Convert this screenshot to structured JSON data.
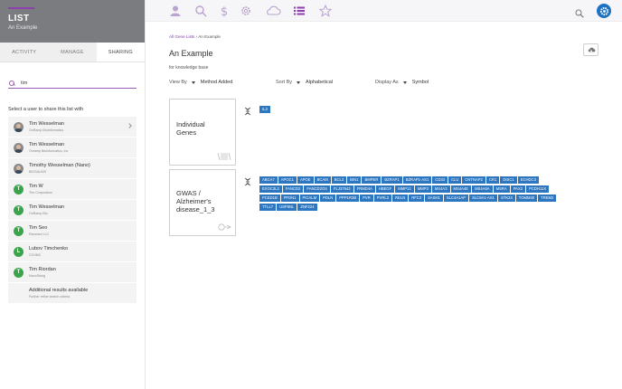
{
  "list_header": {
    "title": "LIST",
    "subtitle": "An Example"
  },
  "tabs": [
    {
      "label": "ACTIVITY"
    },
    {
      "label": "MANAGE"
    },
    {
      "label": "SHARING"
    }
  ],
  "search": {
    "value": "tim",
    "placeholder": ""
  },
  "select_label": "Select a user to share this list with",
  "users": [
    {
      "name": "Tim Wesselman",
      "org": "OnRamp BioInformatics",
      "avatar": "photo"
    },
    {
      "name": "Tim Wesselman",
      "org": "Onramp Bioinformatics, Inc",
      "avatar": "photo"
    },
    {
      "name": "Timothy Wesselman (Nano)",
      "org": "BIOSALINS",
      "avatar": "photo"
    },
    {
      "name": "Tim W",
      "org": "The Corporation",
      "avatar": "T"
    },
    {
      "name": "Tim Wesselman",
      "org": "OnRamp Bio",
      "avatar": "T"
    },
    {
      "name": "Tim Seo",
      "org": "Rammed LLC",
      "avatar": "T"
    },
    {
      "name": "Lubov Timchenko",
      "org": "CCHMC",
      "avatar": "L"
    },
    {
      "name": "Tim Riordan",
      "org": "NanoString",
      "avatar": "T"
    }
  ],
  "more": {
    "title": "Additional results available",
    "note": "Further refine search criteria"
  },
  "topnav": {
    "icons": [
      "user-icon",
      "search-icon",
      "dollar-icon",
      "gear-icon",
      "cloud-icon",
      "list-icon",
      "star-icon"
    ],
    "active": "list-icon",
    "accent": "#1d72c4",
    "brand": "#8e3fb0"
  },
  "breadcrumb": {
    "root": "All Gene Lists",
    "sep": "›",
    "current": "An Example"
  },
  "page": {
    "title": "An Example",
    "subtitle": "for knowledge base"
  },
  "controls": {
    "view_by": {
      "label": "View By",
      "value": "Method Added"
    },
    "sort_by": {
      "label": "Sort By",
      "value": "Alphabetical"
    },
    "display_as": {
      "label": "Display As",
      "value": "Symbol"
    }
  },
  "groups": [
    {
      "title_lines": [
        "Individual",
        "Genes"
      ],
      "genes": [
        "IL3"
      ]
    },
    {
      "title_lines": [
        "GWAS /",
        "Alzheimer's",
        "disease_1_3"
      ],
      "genes": [
        "ABCA7",
        "APOC1",
        "APOE",
        "BCAM",
        "BCL3",
        "BIN1",
        "BMPER",
        "BZRAP1",
        "BZRAP1-AS1",
        "CD33",
        "CLU",
        "CNTNAP2",
        "CR1",
        "DISC1",
        "ECHDC3",
        "EXOC3L2",
        "FANCD2",
        "FANCD2OS",
        "FLJ37543",
        "FRMD4A",
        "HBEGF",
        "MMP12",
        "MMP3",
        "MS4A3",
        "MS4A4E",
        "MS4A6A",
        "MSRA",
        "PAX2",
        "PCDH11X",
        "PCED1B",
        "PFDN1",
        "PICALM",
        "PDLN",
        "PPP1R3B",
        "PVR",
        "PVRL2",
        "RELN",
        "RFC3",
        "SASH1",
        "SLC4A1AP",
        "SLC8A1-AS1",
        "STK24",
        "TOMM40",
        "TREM2",
        "TTLL7",
        "USP6NL",
        "ZNF224"
      ]
    }
  ]
}
